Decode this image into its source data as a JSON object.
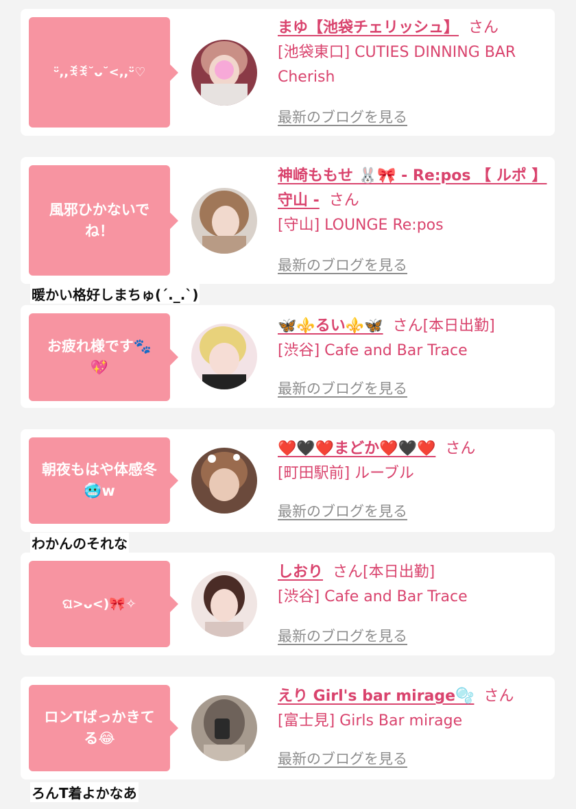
{
  "list": {
    "blog_link_label": "最新のブログを見る",
    "san_label": "さん",
    "accent_color": "#d9436d",
    "bubble_color": "#f794a1",
    "link_color": "#8d8d8d",
    "items": [
      {
        "message": "ᵕ̈,,ꉂꉂ˘ᴗ˘<,,ᵕ̈♡",
        "name": "まゆ【池袋チェリッシュ】",
        "san": "さん",
        "status": "",
        "area_shop": "[池袋東口] CUTIES DINNING BAR Cherish",
        "caption": ""
      },
      {
        "message": "風邪ひかないでね！",
        "name": "神崎ももせ 🐰🎀 - Re:pos 【 ルポ 】守山 -",
        "san": "さん",
        "status": "",
        "area_shop": "[守山] LOUNGE Re:pos",
        "caption": "暖かい格好しまちゅ(´._.`)"
      },
      {
        "message": "お疲れ様です🐾💖",
        "name": "🦋⚜️るい⚜️🦋",
        "san": "さん",
        "status": "[本日出勤]",
        "area_shop": "[渋谷] Cafe and Bar Trace",
        "caption": ""
      },
      {
        "message": "朝夜もはや体感冬🥶w",
        "name": "❤️🖤❤️まどか❤️🖤❤️",
        "san": "さん",
        "status": "",
        "area_shop": "[町田駅前] ルーブル",
        "caption": "わかんのそれな"
      },
      {
        "message": "ଘ>ᴗ<)🎀✧",
        "name": "しおり",
        "san": "さん",
        "status": "[本日出勤]",
        "area_shop": "[渋谷] Cafe and Bar Trace",
        "caption": ""
      },
      {
        "message": "ロンTばっかきてる😂",
        "name": "えり Girl's bar mirage🫧",
        "san": "さん",
        "status": "",
        "area_shop": "[富士見] Girls Bar mirage",
        "caption": "ろんT着よかなあ"
      }
    ]
  }
}
